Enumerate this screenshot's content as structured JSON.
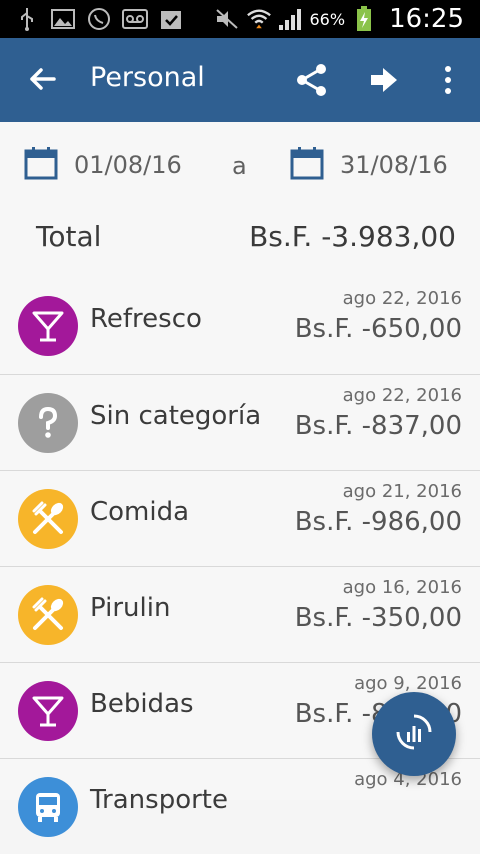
{
  "status_bar": {
    "icons": [
      "usb-icon",
      "image-icon",
      "whatsapp-icon",
      "voicemail-icon",
      "clipboard-icon",
      "mute-icon",
      "wifi-icon",
      "signal-icon",
      "battery-icon"
    ],
    "battery_percent": "66%",
    "time": "16:25"
  },
  "app_bar": {
    "title": "Personal",
    "icons": [
      "back-arrow-icon",
      "share-icon",
      "forward-arrow-icon",
      "more-vert-icon"
    ]
  },
  "date_range": {
    "start": "01/08/16",
    "separator": "a",
    "end": "31/08/16"
  },
  "summary": {
    "label": "Total",
    "value": "Bs.F. -3.983,00"
  },
  "transactions": [
    {
      "category": "Refresco",
      "date": "ago 22, 2016",
      "amount": "Bs.F. -650,00",
      "icon": "cocktail-icon",
      "color": "#a3189a"
    },
    {
      "category": "Sin categoría",
      "date": "ago 22, 2016",
      "amount": "Bs.F. -837,00",
      "icon": "question-icon",
      "color": "#9e9e9e"
    },
    {
      "category": "Comida",
      "date": "ago 21, 2016",
      "amount": "Bs.F. -986,00",
      "icon": "utensils-icon",
      "color": "#f7b52a"
    },
    {
      "category": "Pirulin",
      "date": "ago 16, 2016",
      "amount": "Bs.F. -350,00",
      "icon": "utensils-icon",
      "color": "#f7b52a"
    },
    {
      "category": "Bebidas",
      "date": "ago 9, 2016",
      "amount": "Bs.F. -850,00",
      "icon": "cocktail-icon",
      "color": "#a3189a"
    },
    {
      "category": "Transporte",
      "date": "ago 4, 2016",
      "amount": "",
      "icon": "bus-icon",
      "color": "#3d8fd8"
    }
  ],
  "fab": {
    "icon": "chart-icon"
  },
  "colors": {
    "primary": "#2f5f91",
    "background": "#f7f7f7"
  }
}
